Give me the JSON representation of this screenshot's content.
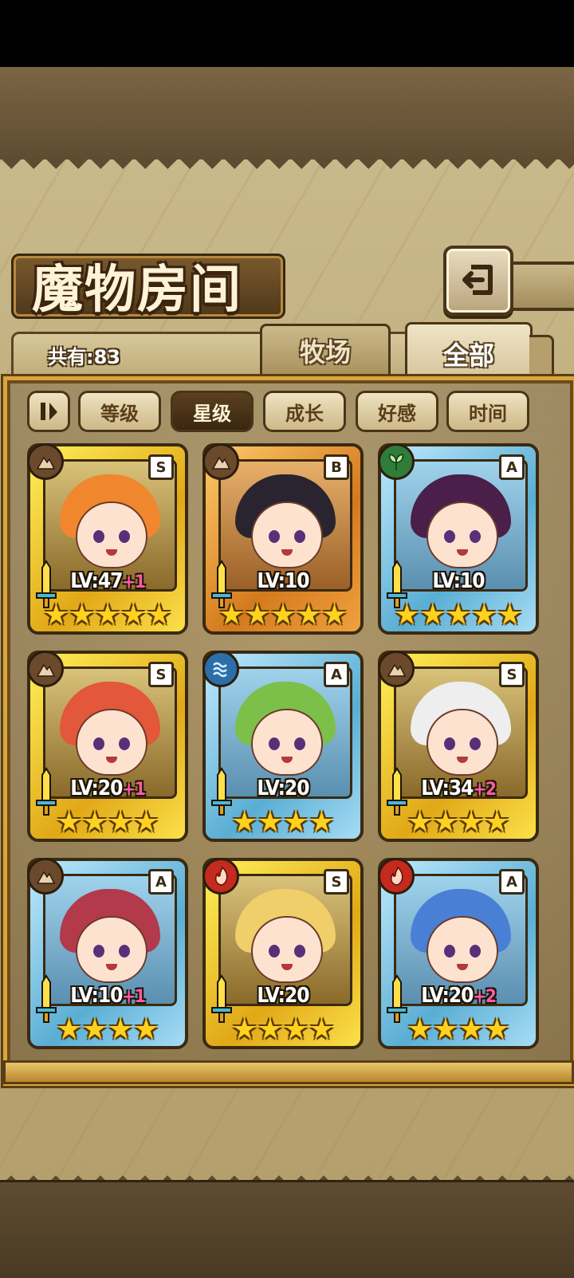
{
  "header": {
    "title": "魔物房间"
  },
  "inventory": {
    "count_label": "共有:83"
  },
  "tabs": [
    {
      "label": "牧场"
    },
    {
      "label": "全部"
    }
  ],
  "sort": {
    "buttons": [
      "等级",
      "星级",
      "成长",
      "好感",
      "时间"
    ],
    "active": "星级"
  },
  "colors": {
    "gold_frame": "#e1a817",
    "bronze_frame": "#d47a1e",
    "blue_frame": "#5aaed3",
    "bonus_pink": "#ff5aa8",
    "star_yellow": "#ffd21f"
  },
  "monsters": [
    {
      "element": "earth",
      "rank": "S",
      "frame": "gold",
      "level_label": "LV:47",
      "bonus": "+1",
      "stars": 5,
      "hair": "#f0872e"
    },
    {
      "element": "earth",
      "rank": "B",
      "frame": "bronze",
      "level_label": "LV:10",
      "bonus": "",
      "stars": 5,
      "hair": "#2a2430"
    },
    {
      "element": "wood",
      "rank": "A",
      "frame": "blue",
      "level_label": "LV:10",
      "bonus": "",
      "stars": 5,
      "hair": "#4a1f4a"
    },
    {
      "element": "earth",
      "rank": "S",
      "frame": "gold",
      "level_label": "LV:20",
      "bonus": "+1",
      "stars": 4,
      "hair": "#e3573b"
    },
    {
      "element": "water",
      "rank": "A",
      "frame": "blue",
      "level_label": "LV:20",
      "bonus": "",
      "stars": 4,
      "hair": "#7cc04a"
    },
    {
      "element": "earth",
      "rank": "S",
      "frame": "gold",
      "level_label": "LV:34",
      "bonus": "+2",
      "stars": 4,
      "hair": "#eeeeee"
    },
    {
      "element": "earth",
      "rank": "A",
      "frame": "blue",
      "level_label": "LV:10",
      "bonus": "+1",
      "stars": 4,
      "hair": "#b23a4a"
    },
    {
      "element": "fire",
      "rank": "S",
      "frame": "gold",
      "level_label": "LV:20",
      "bonus": "",
      "stars": 4,
      "hair": "#f0cf6a"
    },
    {
      "element": "fire",
      "rank": "A",
      "frame": "blue",
      "level_label": "LV:20",
      "bonus": "+2",
      "stars": 4,
      "hair": "#4a7fd6"
    }
  ]
}
